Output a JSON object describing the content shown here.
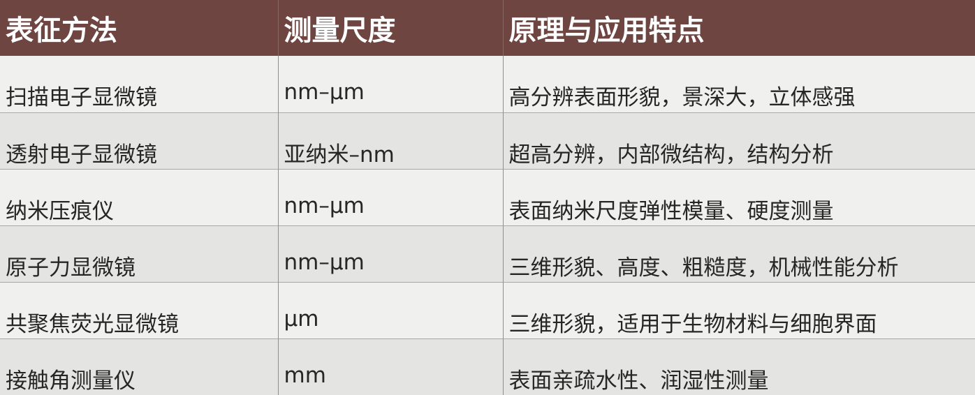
{
  "header": {
    "col1": "表征方法",
    "col2": "测量尺度",
    "col3": "原理与应用特点"
  },
  "rows": [
    {
      "method": "扫描电子显微镜",
      "scale": "nm–μm",
      "feature": "高分辨表面形貌，景深大，立体感强"
    },
    {
      "method": "透射电子显微镜",
      "scale": "亚纳米–nm",
      "feature": "超高分辨，内部微结构，结构分析"
    },
    {
      "method": "纳米压痕仪",
      "scale": "nm–μm",
      "feature": "表面纳米尺度弹性模量、硬度测量"
    },
    {
      "method": "原子力显微镜",
      "scale": "nm–μm",
      "feature": "三维形貌、高度、粗糙度，机械性能分析"
    },
    {
      "method": "共聚焦荧光显微镜",
      "scale": "μm",
      "feature": "三维形貌，适用于生物材料与细胞界面"
    },
    {
      "method": "接触角测量仪",
      "scale": "mm",
      "feature": "表面亲疏水性、润湿性测量"
    }
  ]
}
